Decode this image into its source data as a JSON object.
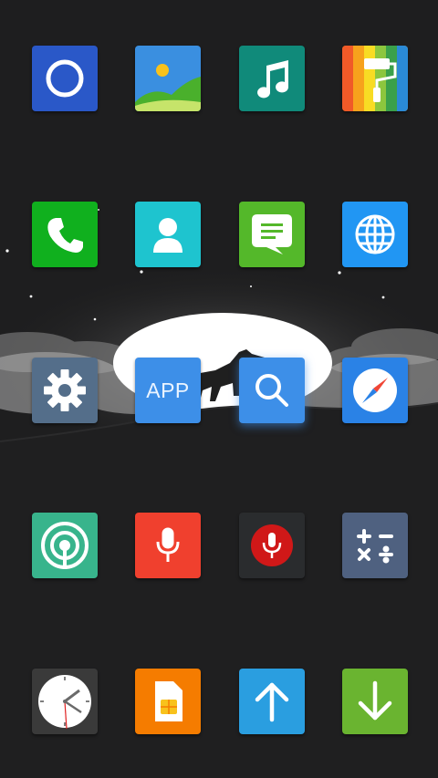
{
  "launcher": {
    "app_folder_label": "APP",
    "icons": [
      {
        "name": "browser-circle-icon",
        "color": "#2a58c8"
      },
      {
        "name": "gallery-icon",
        "color": "#3a8fe0"
      },
      {
        "name": "music-icon",
        "color": "#108a7a"
      },
      {
        "name": "theme-paint-roller-icon",
        "color": "#f57c00"
      },
      {
        "name": "phone-icon",
        "color": "#10b01e"
      },
      {
        "name": "contacts-icon",
        "color": "#1ec4cf"
      },
      {
        "name": "messages-icon",
        "color": "#54b82a"
      },
      {
        "name": "globe-icon",
        "color": "#2196f3"
      },
      {
        "name": "settings-gear-icon",
        "color": "#546e8a"
      },
      {
        "name": "app-folder-icon",
        "color": "#3d8fe8"
      },
      {
        "name": "search-icon",
        "color": "#3d8fe8"
      },
      {
        "name": "compass-icon",
        "color": "#2a82e6"
      },
      {
        "name": "hotspot-icon",
        "color": "#38b48c"
      },
      {
        "name": "voice-recorder-icon",
        "color": "#f0402e"
      },
      {
        "name": "microphone-icon",
        "color": "#2a2c2e"
      },
      {
        "name": "calculator-icon",
        "color": "#4f6180"
      },
      {
        "name": "clock-icon",
        "color": "#3a3a3a"
      },
      {
        "name": "sim-card-icon",
        "color": "#f57c00"
      },
      {
        "name": "upload-arrow-icon",
        "color": "#2a9ee0"
      },
      {
        "name": "download-arrow-icon",
        "color": "#6ab430"
      }
    ]
  }
}
